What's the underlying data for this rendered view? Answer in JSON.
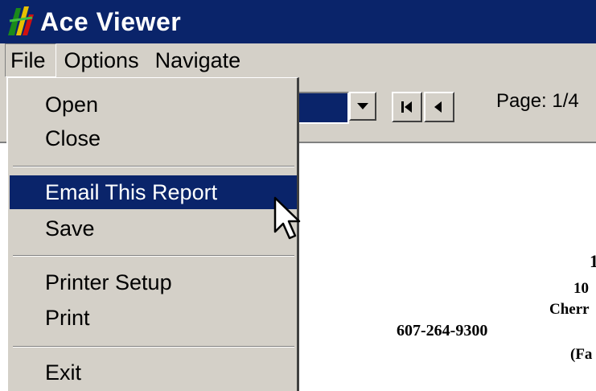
{
  "window": {
    "title": "Ace Viewer"
  },
  "menubar": {
    "items": [
      "File",
      "Options",
      "Navigate"
    ]
  },
  "toolbar": {
    "page_label": "Page: 1/4"
  },
  "file_menu": {
    "items": [
      "Open",
      "Close",
      "Email This Report",
      "Save",
      "Printer Setup",
      "Print",
      "Exit"
    ],
    "highlighted": "Email This Report"
  },
  "document": {
    "lines": [
      "1",
      "10",
      "Cherr",
      "607-264-9300",
      "(Fa"
    ]
  },
  "icons": {
    "app": "ace-app-icon",
    "combo_arrow": "triangle-down-icon",
    "first_page": "first-page-icon",
    "prev_page": "previous-page-icon",
    "cursor": "mouse-pointer-icon"
  },
  "colors": {
    "titlebar": "#0a246a",
    "highlight": "#0a246a",
    "face": "#d4d0c8"
  }
}
